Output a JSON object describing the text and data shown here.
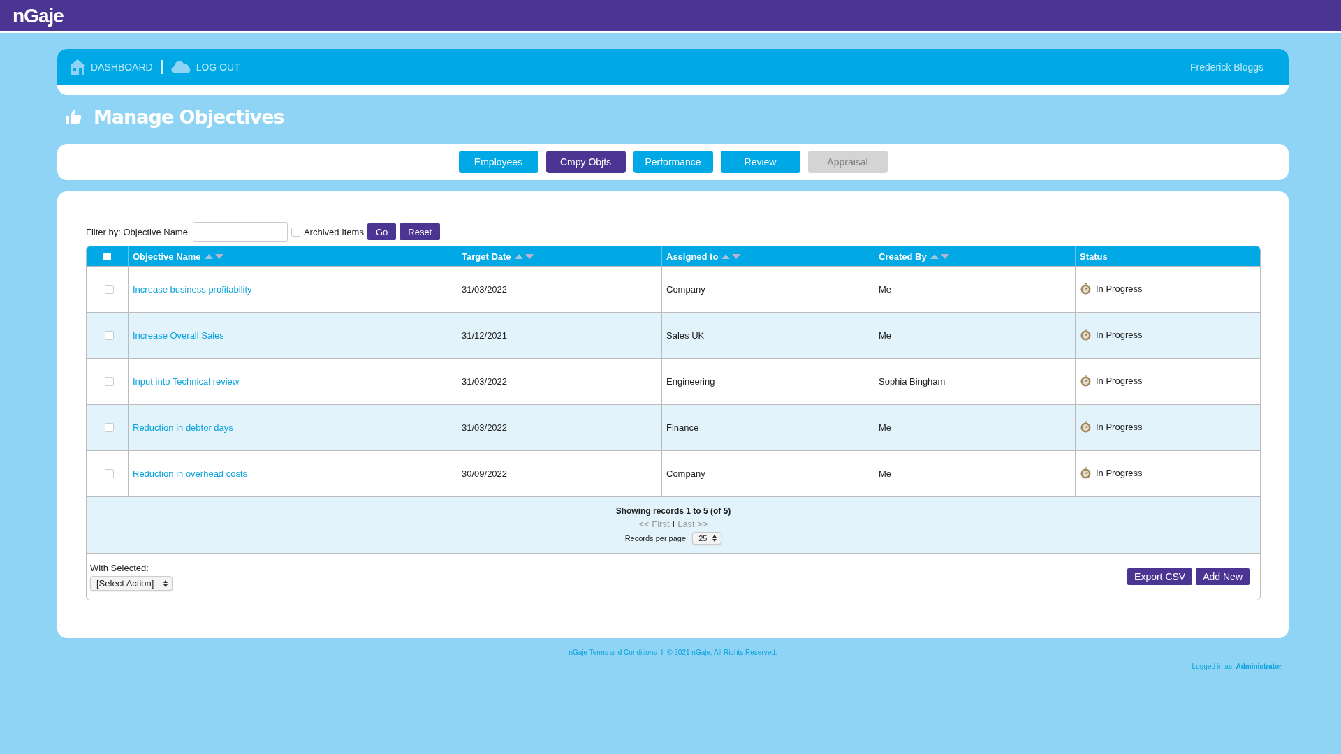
{
  "logo": {
    "text": "nGaje"
  },
  "nav": {
    "links": [
      {
        "kind": "home",
        "label": "DASHBOARD"
      },
      {
        "kind": "cloud",
        "label": "LOG OUT"
      }
    ],
    "user": "Frederick Bloggs"
  },
  "page_title": "Manage Objectives",
  "tabs": [
    {
      "label": "Employees",
      "selected": false,
      "disabled": false
    },
    {
      "label": "Cmpy Objts",
      "selected": true,
      "disabled": false
    },
    {
      "label": "Performance",
      "selected": false,
      "disabled": false
    },
    {
      "label": "Review",
      "selected": false,
      "disabled": false
    },
    {
      "label": "Appraisal",
      "selected": false,
      "disabled": true
    }
  ],
  "filter": {
    "label": "Filter by: Objective Name",
    "archived_label": "Archived Items",
    "archived_checked": false,
    "go": "Go",
    "reset": "Reset"
  },
  "table": {
    "select_all_checked": false,
    "columns": [
      {
        "label": "Objective Name",
        "sortable": true
      },
      {
        "label": "Target Date",
        "sortable": true
      },
      {
        "label": "Assigned to",
        "sortable": true
      },
      {
        "label": "Created By",
        "sortable": true
      },
      {
        "label": "Status",
        "sortable": false
      }
    ],
    "rows": [
      {
        "checked": false,
        "name": "Increase business profitability",
        "date": "31/03/2022",
        "assigned": "Company",
        "created_by": "Me",
        "status": "In Progress"
      },
      {
        "checked": false,
        "name": "Increase Overall Sales",
        "date": "31/12/2021",
        "assigned": "Sales UK",
        "created_by": "Me",
        "status": "In Progress"
      },
      {
        "checked": false,
        "name": "Input into Technical review",
        "date": "31/03/2022",
        "assigned": "Engineering",
        "created_by": "Sophia Bingham",
        "status": "In Progress"
      },
      {
        "checked": false,
        "name": "Reduction in debtor days",
        "date": "31/03/2022",
        "assigned": "Finance",
        "created_by": "Me",
        "status": "In Progress"
      },
      {
        "checked": false,
        "name": "Reduction in overhead costs",
        "date": "30/09/2022",
        "assigned": "Company",
        "created_by": "Me",
        "status": "In Progress"
      }
    ]
  },
  "pagination": {
    "summary": "Showing records 1 to 5 (of 5)",
    "first": "<< First",
    "separator": "I",
    "last": "Last >>",
    "per_page_label": "Records per page:",
    "per_page": "25"
  },
  "bulk": {
    "label": "With Selected:",
    "action": "[Select Action]"
  },
  "buttons": [
    "Export CSV",
    "Add New"
  ],
  "footer": {
    "terms": "nGaje Terms and Conditions",
    "separator": "I",
    "copyright": "© 2021 nGaje. All Rights Reserved.",
    "logged_in": "Logged in as: **Administrator**"
  }
}
